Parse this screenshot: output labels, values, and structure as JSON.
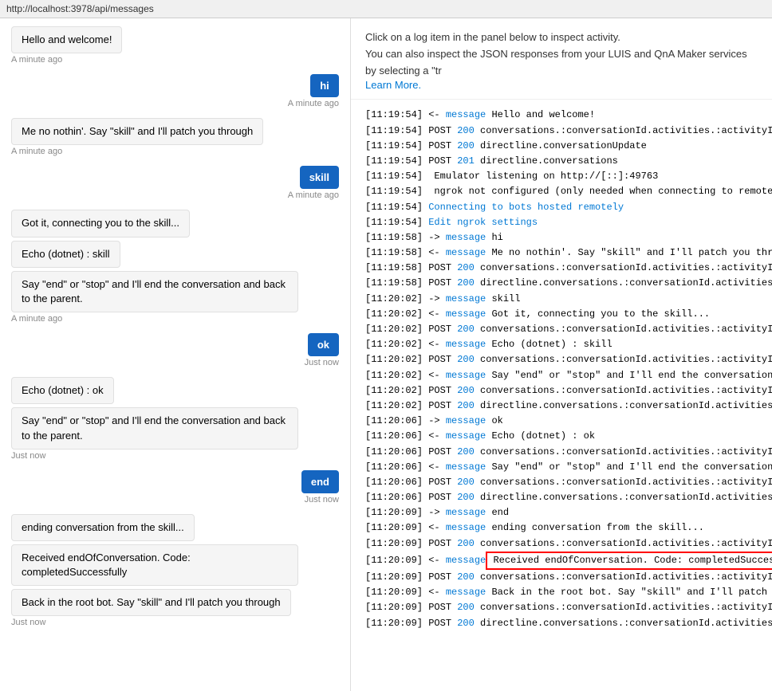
{
  "topbar": {
    "url": "http://localhost:3978/api/messages"
  },
  "inspect_header": {
    "line1": "Click on a log item in the panel below to inspect activity.",
    "line2": "You can also inspect the JSON responses from your LUIS and QnA Maker services by selecting a \"tr",
    "learn_more": "Learn More."
  },
  "chat_messages": [
    {
      "type": "bot",
      "text": "Hello and welcome!",
      "timestamp": "A minute ago"
    },
    {
      "type": "user",
      "text": "hi",
      "timestamp": "A minute ago"
    },
    {
      "type": "bot",
      "text": "Me no nothin'. Say \"skill\" and I'll patch you through",
      "timestamp": "A minute ago"
    },
    {
      "type": "user",
      "text": "skill",
      "timestamp": "A minute ago"
    },
    {
      "type": "bot",
      "text": "Got it, connecting you to the skill...",
      "timestamp": null
    },
    {
      "type": "bot",
      "text": "Echo (dotnet) : skill",
      "timestamp": null
    },
    {
      "type": "bot",
      "text": "Say \"end\" or \"stop\" and I'll end the conversation and back to the parent.",
      "timestamp": "A minute ago"
    },
    {
      "type": "user",
      "text": "ok",
      "timestamp": "Just now"
    },
    {
      "type": "bot",
      "text": "Echo (dotnet) : ok",
      "timestamp": null
    },
    {
      "type": "bot",
      "text": "Say \"end\" or \"stop\" and I'll end the conversation and back to the parent.",
      "timestamp": "Just now"
    },
    {
      "type": "user",
      "text": "end",
      "timestamp": "Just now"
    },
    {
      "type": "bot",
      "text": "ending conversation from the skill...",
      "timestamp": null
    },
    {
      "type": "bot",
      "text": "Received endOfConversation.\nCode: completedSuccessfully",
      "timestamp": null
    },
    {
      "type": "bot",
      "text": "Back in the root bot. Say \"skill\" and I'll patch you through",
      "timestamp": "Just now"
    }
  ],
  "log_lines": [
    {
      "time": "[11:19:54]",
      "dir": "<-",
      "type": "message",
      "text": " Hello and welcome!",
      "highlight": false
    },
    {
      "time": "[11:19:54]",
      "dir": "POST",
      "status": "200",
      "path": " conversations.:conversationId.activities.:activityId",
      "highlight": false
    },
    {
      "time": "[11:19:54]",
      "dir": "POST",
      "status": "200",
      "path": " directline.conversationUpdate",
      "highlight": false
    },
    {
      "time": "[11:19:54]",
      "dir": "POST",
      "status": "201",
      "path": " directline.conversations",
      "highlight": false
    },
    {
      "time": "[11:19:54]",
      "dir": null,
      "text": " Emulator listening on http://[::]:49763",
      "highlight": false
    },
    {
      "time": "[11:19:54]",
      "dir": null,
      "text": " ngrok not configured (only needed when connecting to remotely hoste",
      "highlight": false
    },
    {
      "time": "[11:19:54]",
      "dir": null,
      "link": "Connecting to bots hosted remotely",
      "highlight": false
    },
    {
      "time": "[11:19:54]",
      "dir": null,
      "link": "Edit ngrok settings",
      "highlight": false
    },
    {
      "time": "[11:19:58]",
      "dir": "->",
      "type": "message",
      "text": " hi",
      "highlight": false
    },
    {
      "time": "[11:19:58]",
      "dir": "<-",
      "type": "message",
      "text": " Me no nothin'. Say \"skill\" and I'll patch you thro...",
      "highlight": false
    },
    {
      "time": "[11:19:58]",
      "dir": "POST",
      "status": "200",
      "path": " conversations.:conversationId.activities.:activityId",
      "highlight": false
    },
    {
      "time": "[11:19:58]",
      "dir": "POST",
      "status": "200",
      "path": " directline.conversations.:conversationId.activities",
      "highlight": false
    },
    {
      "time": "[11:20:02]",
      "dir": "->",
      "type": "message",
      "text": " skill",
      "highlight": false
    },
    {
      "time": "[11:20:02]",
      "dir": "<-",
      "type": "message",
      "text": " Got it, connecting you to the skill...",
      "highlight": false
    },
    {
      "time": "[11:20:02]",
      "dir": "POST",
      "status": "200",
      "path": " conversations.:conversationId.activities.:activityId",
      "highlight": false
    },
    {
      "time": "[11:20:02]",
      "dir": "<-",
      "type": "message",
      "text": " Echo (dotnet) : skill",
      "highlight": false
    },
    {
      "time": "[11:20:02]",
      "dir": "POST",
      "status": "200",
      "path": " conversations.:conversationId.activities.:activityId",
      "highlight": false
    },
    {
      "time": "[11:20:02]",
      "dir": "<-",
      "type": "message",
      "text": " Say \"end\" or \"stop\" and I'll end the conversation ...",
      "highlight": false
    },
    {
      "time": "[11:20:02]",
      "dir": "POST",
      "status": "200",
      "path": " conversations.:conversationId.activities.:activityId",
      "highlight": false
    },
    {
      "time": "[11:20:02]",
      "dir": "POST",
      "status": "200",
      "path": " directline.conversations.:conversationId.activities",
      "highlight": false
    },
    {
      "time": "[11:20:06]",
      "dir": "->",
      "type": "message",
      "text": " ok",
      "highlight": false
    },
    {
      "time": "[11:20:06]",
      "dir": "<-",
      "type": "message",
      "text": " Echo (dotnet) : ok",
      "highlight": false
    },
    {
      "time": "[11:20:06]",
      "dir": "POST",
      "status": "200",
      "path": " conversations.:conversationId.activities.:activityId",
      "highlight": false
    },
    {
      "time": "[11:20:06]",
      "dir": "<-",
      "type": "message",
      "text": " Say \"end\" or \"stop\" and I'll end the conversation ...",
      "highlight": false
    },
    {
      "time": "[11:20:06]",
      "dir": "POST",
      "status": "200",
      "path": " conversations.:conversationId.activities.:activityId",
      "highlight": false
    },
    {
      "time": "[11:20:06]",
      "dir": "POST",
      "status": "200",
      "path": " directline.conversations.:conversationId.activities",
      "highlight": false
    },
    {
      "time": "[11:20:09]",
      "dir": "->",
      "type": "message",
      "text": " end",
      "highlight": false
    },
    {
      "time": "[11:20:09]",
      "dir": "<-",
      "type": "message",
      "text": " ending conversation from the skill...",
      "highlight": false
    },
    {
      "time": "[11:20:09]",
      "dir": "POST",
      "status": "200",
      "path": " conversations.:conversationId.activities.:activityId",
      "highlight": false
    },
    {
      "time": "[11:20:09]",
      "dir": "<-",
      "type": "message",
      "text": " Received endOfConversation. Code: completedSucces...",
      "highlight": true
    },
    {
      "time": "[11:20:09]",
      "dir": "POST",
      "status": "200",
      "path": " conversations.:conversationId.activities.:activityId",
      "highlight": false
    },
    {
      "time": "[11:20:09]",
      "dir": "<-",
      "type": "message",
      "text": " Back in the root bot. Say \"skill\" and I'll patch y...",
      "highlight": false
    },
    {
      "time": "[11:20:09]",
      "dir": "POST",
      "status": "200",
      "path": " conversations.:conversationId.activities.:activityId",
      "highlight": false
    },
    {
      "time": "[11:20:09]",
      "dir": "POST",
      "status": "200",
      "path": " directline.conversations.:conversationId.activities",
      "highlight": false
    }
  ]
}
